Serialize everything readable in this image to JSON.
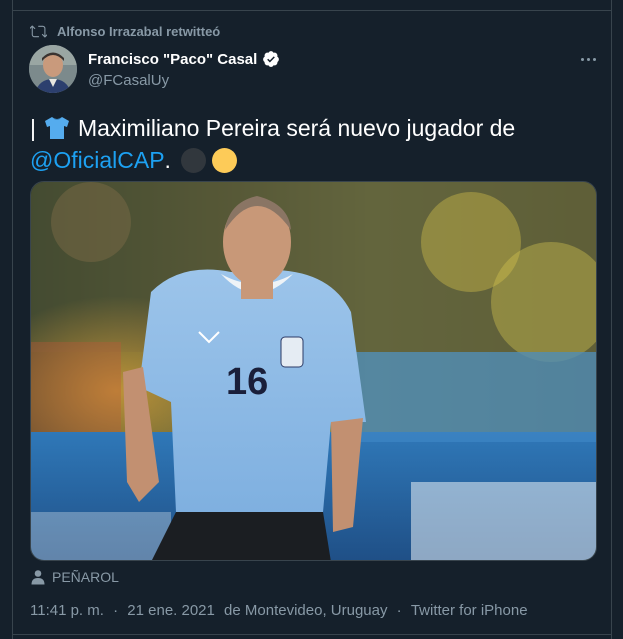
{
  "retweet": {
    "text": "Alfonso Irrazabal retwitteó",
    "icon": "retweet-icon"
  },
  "author": {
    "name": "Francisco \"Paco\" Casal",
    "handle": "@FCasalUy",
    "verified": true,
    "avatar_icon": "avatar"
  },
  "tweet": {
    "prefix": "|",
    "emoji_shirt": "shirt-icon",
    "text": "Maximiliano Pereira será nuevo jugador de",
    "mention": "@OficialCAP",
    "suffix": ".",
    "emoji_colors": [
      "#31373d",
      "#fdcb58"
    ]
  },
  "media": {
    "jersey_number": "16"
  },
  "location": {
    "label": "PEÑAROL",
    "icon": "person-icon"
  },
  "meta": {
    "time": "11:41 p. m.",
    "sep1": "·",
    "date": "21 ene. 2021",
    "place": "de Montevideo, Uruguay",
    "sep2": "·",
    "source": "Twitter for iPhone"
  },
  "colors": {
    "background": "#15202b",
    "border": "#38444d",
    "secondary_text": "#8899a6",
    "link": "#1da1f2"
  }
}
